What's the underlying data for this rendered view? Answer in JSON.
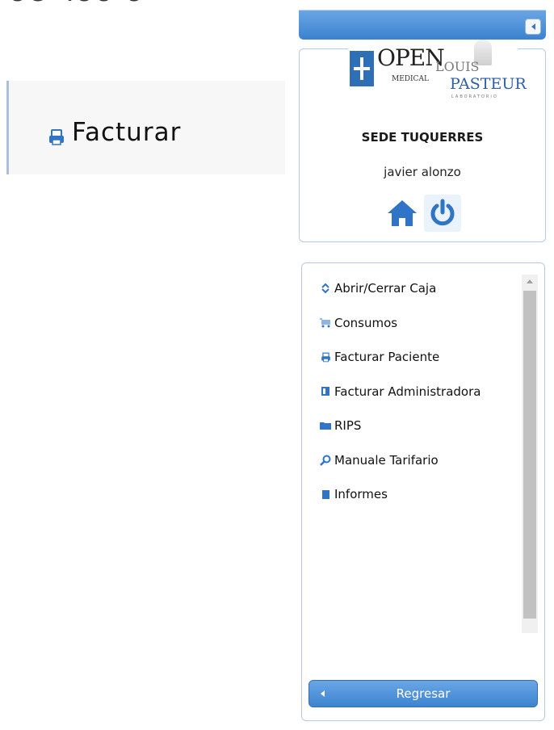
{
  "header": {
    "fragment": "ос чоо о"
  },
  "page": {
    "title": "Facturar",
    "title_icon": "printer-icon"
  },
  "sidebar": {
    "collapse_icon": "chevron-left-icon",
    "logo": {
      "open": "OPEN",
      "medical": "MEDICAL",
      "louis": "LOUIS",
      "pasteur": "PASTEUR",
      "lab": "LABORATORIO"
    },
    "sede": "SEDE TUQUERRES",
    "user": "javier alonzo",
    "home_icon": "home-icon",
    "power_icon": "power-icon",
    "menu": [
      {
        "label": "Abrir/Cerrar Caja",
        "icon": "updown-arrows-icon"
      },
      {
        "label": "Consumos",
        "icon": "cart-icon"
      },
      {
        "label": "Facturar Paciente",
        "icon": "printer-icon"
      },
      {
        "label": "Facturar Administradora",
        "icon": "book-icon"
      },
      {
        "label": "RIPS",
        "icon": "folder-icon"
      },
      {
        "label": "Manuale Tarifario",
        "icon": "search-icon"
      },
      {
        "label": "Informes",
        "icon": "notebook-icon"
      }
    ],
    "back_label": "Regresar"
  },
  "colors": {
    "accent": "#3a82cf",
    "accent_light": "#6aa6e4",
    "border": "#b8cbe0"
  }
}
